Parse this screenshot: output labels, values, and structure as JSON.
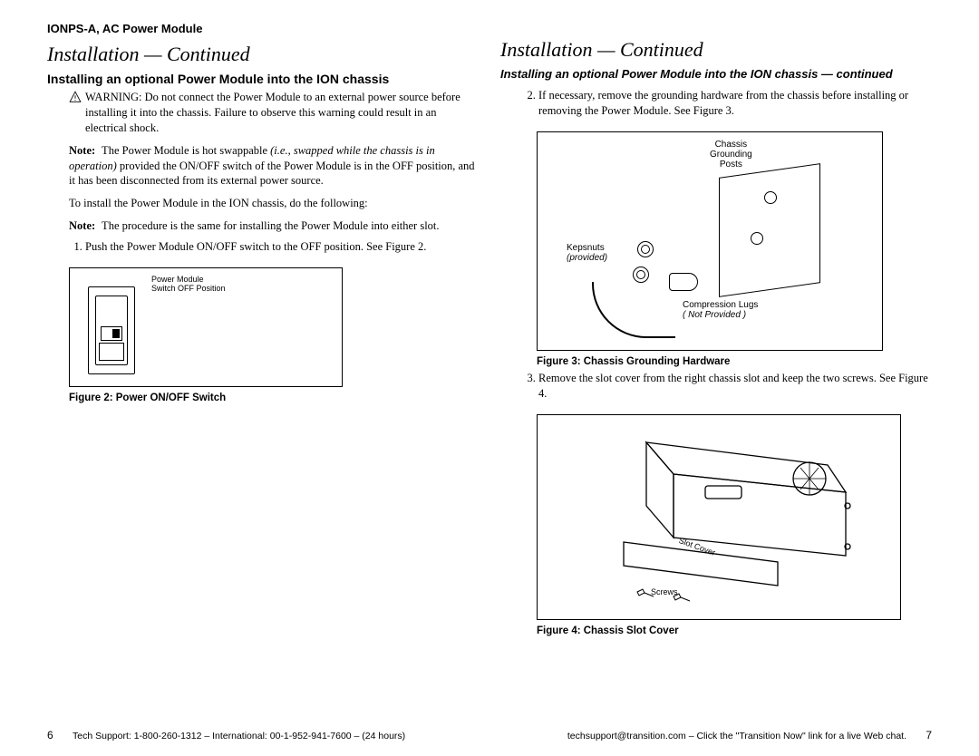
{
  "left": {
    "header": "IONPS-A, AC Power Module",
    "section_title": "Installation — Continued",
    "subhead": "Installing an optional Power Module into the ION chassis",
    "warning_label": "WARNING:",
    "warning_text": " Do not connect the Power Module to an external power source before installing it into the chassis. Failure to observe this warning could result in an electrical shock.",
    "note1_label": "Note:",
    "note1_prefix": " The Power Module is hot swappable ",
    "note1_italic": "(i.e., swapped while the chassis is in operation)",
    "note1_suffix": " provided the ON/OFF switch of the Power Module is in the OFF position, and it has been disconnected from its external power source.",
    "intro": "To install the Power Module in the ION chassis, do the following:",
    "note2_label": "Note:",
    "note2_text": " The procedure is the same for installing the Power Module into either slot.",
    "step1": "Push the Power Module ON/OFF switch to the OFF position. See Figure 2.",
    "fig2_label_line1": "Power Module",
    "fig2_label_line2": "Switch OFF Position",
    "fig2_caption": "Figure 2:  Power ON/OFF Switch",
    "page_number": "6",
    "footer": "Tech Support:  1-800-260-1312 – International:  00-1-952-941-7600 – (24 hours)"
  },
  "right": {
    "section_title": "Installation — Continued",
    "subhead_italic": "Installing an optional Power Module into the ION chassis — continued",
    "step2": "If necessary, remove the grounding hardware from the chassis before installing or removing the Power Module. See Figure 3.",
    "fig3_label_chassis_l1": "Chassis",
    "fig3_label_chassis_l2": "Grounding",
    "fig3_label_chassis_l3": "Posts",
    "fig3_label_kep_l1": "Kepsnuts",
    "fig3_label_kep_l2": "(provided)",
    "fig3_label_lug_l1": "Compression Lugs",
    "fig3_label_lug_l2": "( Not Provided )",
    "fig3_caption": "Figure 3:  Chassis Grounding Hardware",
    "step3": "Remove the slot cover from the right chassis slot and keep the two screws. See Figure 4.",
    "fig4_label_slot": "Slot Cover",
    "fig4_label_screws": "Screws",
    "fig4_caption": "Figure 4:  Chassis Slot Cover",
    "page_number": "7",
    "footer": "techsupport@transition.com – Click the \"Transition Now\" link for a live Web chat."
  }
}
